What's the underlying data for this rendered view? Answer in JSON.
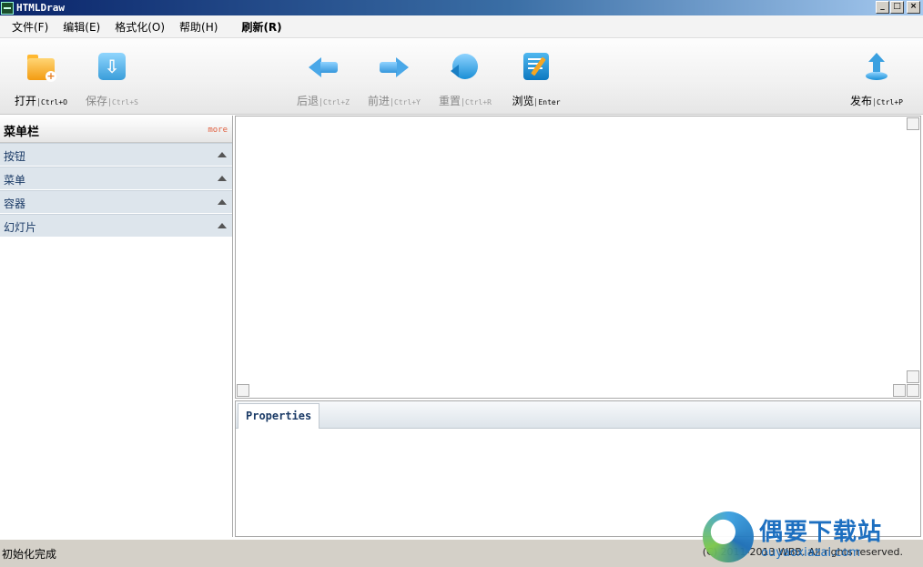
{
  "window": {
    "title": "HTMLDraw",
    "buttons": {
      "minimize": "_",
      "maximize": "□",
      "close": "×"
    }
  },
  "menu": [
    {
      "label": "文件(F)"
    },
    {
      "label": "编辑(E)"
    },
    {
      "label": "格式化(O)"
    },
    {
      "label": "帮助(H)"
    },
    {
      "label": "刷新(R)"
    }
  ],
  "toolbar": {
    "open": {
      "label": "打开",
      "shortcut": "Ctrl+O",
      "icon": "open-folder-icon"
    },
    "save": {
      "label": "保存",
      "shortcut": "Ctrl+S",
      "icon": "save-icon"
    },
    "back": {
      "label": "后退",
      "shortcut": "Ctrl+Z",
      "icon": "arrow-left-icon"
    },
    "forward": {
      "label": "前进",
      "shortcut": "Ctrl+Y",
      "icon": "arrow-right-icon"
    },
    "reset": {
      "label": "重置",
      "shortcut": "Ctrl+R",
      "icon": "reset-icon"
    },
    "browse": {
      "label": "浏览",
      "shortcut": "Enter",
      "icon": "browse-icon"
    },
    "publish": {
      "label": "发布",
      "shortcut": "Ctrl+P",
      "icon": "publish-icon"
    }
  },
  "sidebar": {
    "title": "菜单栏",
    "more": "more",
    "items": [
      {
        "label": "按钮"
      },
      {
        "label": "菜单"
      },
      {
        "label": "容器"
      },
      {
        "label": "幻灯片"
      }
    ]
  },
  "properties": {
    "tab": "Properties"
  },
  "status": {
    "left": "初始化完成",
    "right": "(C) 2011-2013 WBB. All rights reserved."
  },
  "watermark": {
    "brand": "偶要下载站",
    "url": "ouyaoxiazai.com"
  },
  "colors": {
    "titlebar": "#0a246a",
    "sidebar_item": "#dde5ec",
    "accent": "#1a8fd6"
  }
}
